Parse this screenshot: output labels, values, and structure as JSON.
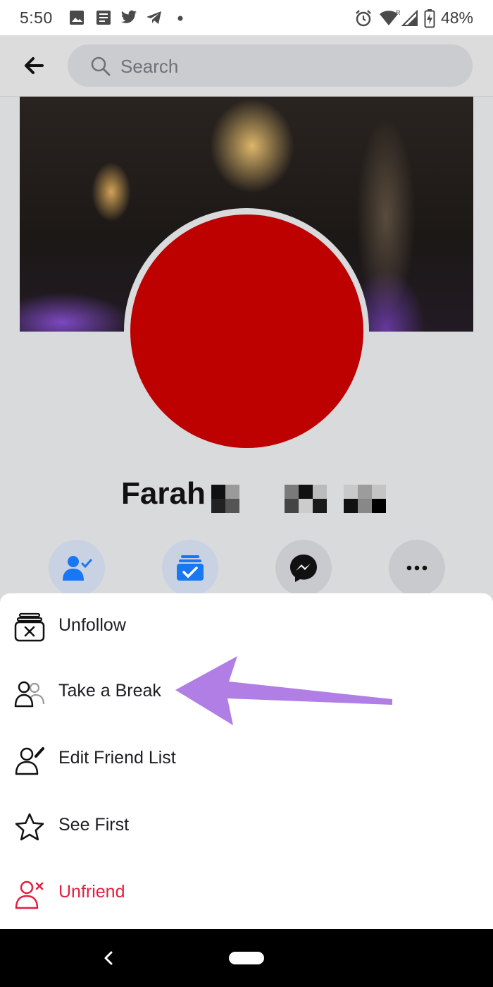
{
  "status_bar": {
    "time": "5:50",
    "battery": "48%",
    "icons": [
      "image-icon",
      "news-icon",
      "twitter-icon",
      "telegram-icon",
      "dot-icon",
      "alarm-icon",
      "wifi-icon",
      "signal-icon",
      "battery-icon"
    ]
  },
  "top_bar": {
    "search_placeholder": "Search"
  },
  "profile": {
    "name": "Farah",
    "picture_color": "#bd0000"
  },
  "actions": [
    {
      "icon": "friends-check-icon"
    },
    {
      "icon": "following-icon"
    },
    {
      "icon": "messenger-icon"
    },
    {
      "icon": "more-icon"
    }
  ],
  "menu": {
    "items": [
      {
        "label": "Unfollow",
        "icon": "unfollow-icon"
      },
      {
        "label": "Take a Break",
        "icon": "take-break-icon"
      },
      {
        "label": "Edit Friend List",
        "icon": "edit-friend-list-icon"
      },
      {
        "label": "See First",
        "icon": "star-icon"
      },
      {
        "label": "Unfriend",
        "icon": "unfriend-icon"
      }
    ],
    "unfriend_color": "#e41e3f"
  },
  "annotation": {
    "arrow_color": "#b07ee4"
  },
  "colors": {
    "accent": "#1877f2",
    "background": "#d9dadc"
  }
}
